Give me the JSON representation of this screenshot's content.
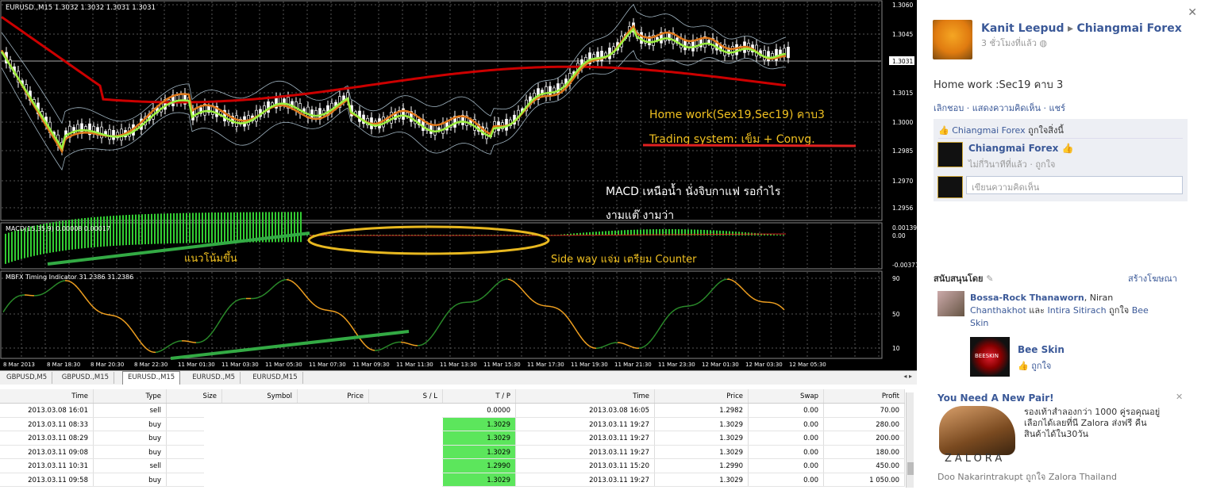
{
  "chart": {
    "symbol_info": "EURUSD.,M15  1.3032 1.3032 1.3031 1.3031",
    "price_ticks": [
      "1.3060",
      "1.3045",
      "1.3031",
      "1.3015",
      "1.3000",
      "1.2985",
      "1.2970",
      "1.2956"
    ],
    "macd_label": "MACD(15,35,9) 0.00008 0.00017",
    "macd_ticks": [
      "0.00139",
      "0.00",
      "-0.00371"
    ],
    "mbfx_label": "MBFX Timing Indicator 31.2386 31.2386",
    "mbfx_ticks": [
      "90",
      "50",
      "10"
    ],
    "time_ticks": [
      "8 Mar 2013",
      "8 Mar 18:30",
      "8 Mar 20:30",
      "8 Mar 22:30",
      "11 Mar 01:30",
      "11 Mar 03:30",
      "11 Mar 05:30",
      "11 Mar 07:30",
      "11 Mar 09:30",
      "11 Mar 11:30",
      "11 Mar 13:30",
      "11 Mar 15:30",
      "11 Mar 17:30",
      "11 Mar 19:30",
      "11 Mar 21:30",
      "11 Mar 23:30",
      "12 Mar 01:30",
      "12 Mar 03:30",
      "12 Mar 05:30"
    ],
    "annotations": {
      "homework": "Home work(Sex19,Sec19) คาบ3",
      "trading_system": "Trading system: เข็ม   + Convg.",
      "macd_note": "MACD เหนือน้ำ   นั่งจิบกาแฟ   รอกำไร",
      "macd_note2": "งามแต๊   งามว่า",
      "trend_note": "แนวโน้มขึ้น",
      "sideway_note": "Side way แจ่ม   เตรียม   Counter"
    },
    "colors": {
      "ma_slow": "#cc0000",
      "ma_mid": "#e0781a",
      "ma_fast": "#9cf040",
      "macd": "#33cc33",
      "mbfx_up": "#2a8a2a",
      "mbfx_down": "#f0a020",
      "ellipse": "#e8b820"
    }
  },
  "tabs": [
    "GBPUSD,M5",
    "GBPUSD.,M15",
    "EURUSD.,M15",
    "EURUSD.,M5",
    "EURUSD,M15"
  ],
  "active_tab": "EURUSD.,M15",
  "terminal": {
    "headers": [
      "Time",
      "Type",
      "Size",
      "Symbol",
      "Price",
      "S / L",
      "T / P",
      "Time",
      "Price",
      "Swap",
      "Profit"
    ],
    "rows": [
      {
        "time": "2013.03.08 16:01",
        "type": "sell",
        "tp": "0.0000",
        "ctime": "2013.03.08 16:05",
        "cprice": "1.2982",
        "swap": "0.00",
        "profit": "70.00"
      },
      {
        "time": "2013.03.11 08:33",
        "type": "buy",
        "tp": "1.3029",
        "ctime": "2013.03.11 19:27",
        "cprice": "1.3029",
        "swap": "0.00",
        "profit": "280.00"
      },
      {
        "time": "2013.03.11 08:29",
        "type": "buy",
        "tp": "1.3029",
        "ctime": "2013.03.11 19:27",
        "cprice": "1.3029",
        "swap": "0.00",
        "profit": "200.00"
      },
      {
        "time": "2013.03.11 09:08",
        "type": "buy",
        "tp": "1.3029",
        "ctime": "2013.03.11 19:27",
        "cprice": "1.3029",
        "swap": "0.00",
        "profit": "180.00"
      },
      {
        "time": "2013.03.11 10:31",
        "type": "sell",
        "tp": "1.2990",
        "ctime": "2013.03.11 15:20",
        "cprice": "1.2990",
        "swap": "0.00",
        "profit": "450.00"
      },
      {
        "time": "2013.03.11 09:58",
        "type": "buy",
        "tp": "1.3029",
        "ctime": "2013.03.11 19:27",
        "cprice": "1.3029",
        "swap": "0.00",
        "profit": "1 050.00"
      }
    ]
  },
  "fb": {
    "author": "Kanit Leepud",
    "arrow": "▸",
    "group": "Chiangmai Forex",
    "time": "3 ชั่วโมงที่แล้ว",
    "post_text": "Home work :Sec19 คาบ 3",
    "actions": "เลิกชอบ · แสดงความคิดเห็น · แชร์",
    "likes_text": "ถูกใจสิ่งนี้",
    "likes_page": "Chiangmai Forex",
    "comment_author": "Chiangmai Forex",
    "comment_meta": "ไม่กี่วินาทีที่แล้ว · ถูกใจ",
    "comment_placeholder": "เขียนความคิดเห็น",
    "sponsored_label": "สนับสนุนโดย",
    "create_ad": "สร้างโฆษณา",
    "ad1_names1": "Bossa-Rock Thanaworn",
    "ad1_names1b": ", Niran",
    "ad1_names2": "Chanthakhot",
    "ad1_and": " และ ",
    "ad1_names3": "Intira Sitirach",
    "ad1_likes": " ถูกใจ ",
    "ad1_page1": "Bee",
    "ad1_page2": "Skin",
    "ad1_title": "Bee Skin",
    "ad1_like": "ถูกใจ",
    "ad2_title": "You Need A New Pair!",
    "ad2_text1": "รองเท้าสำลองกว่า 1000 คู่รอคุณอยู่",
    "ad2_text2": "เลือกได้เลยที่นี Zalora ส่งฟรี คืน",
    "ad2_text3": "สินค้าได้ใน30วัน",
    "ad2_brand": "ZALORA",
    "ad2_footer": "Doo Nakarintrakupt ถูกใจ Zalora Thailand",
    "ad1_logo_text": "BEESKIN"
  }
}
